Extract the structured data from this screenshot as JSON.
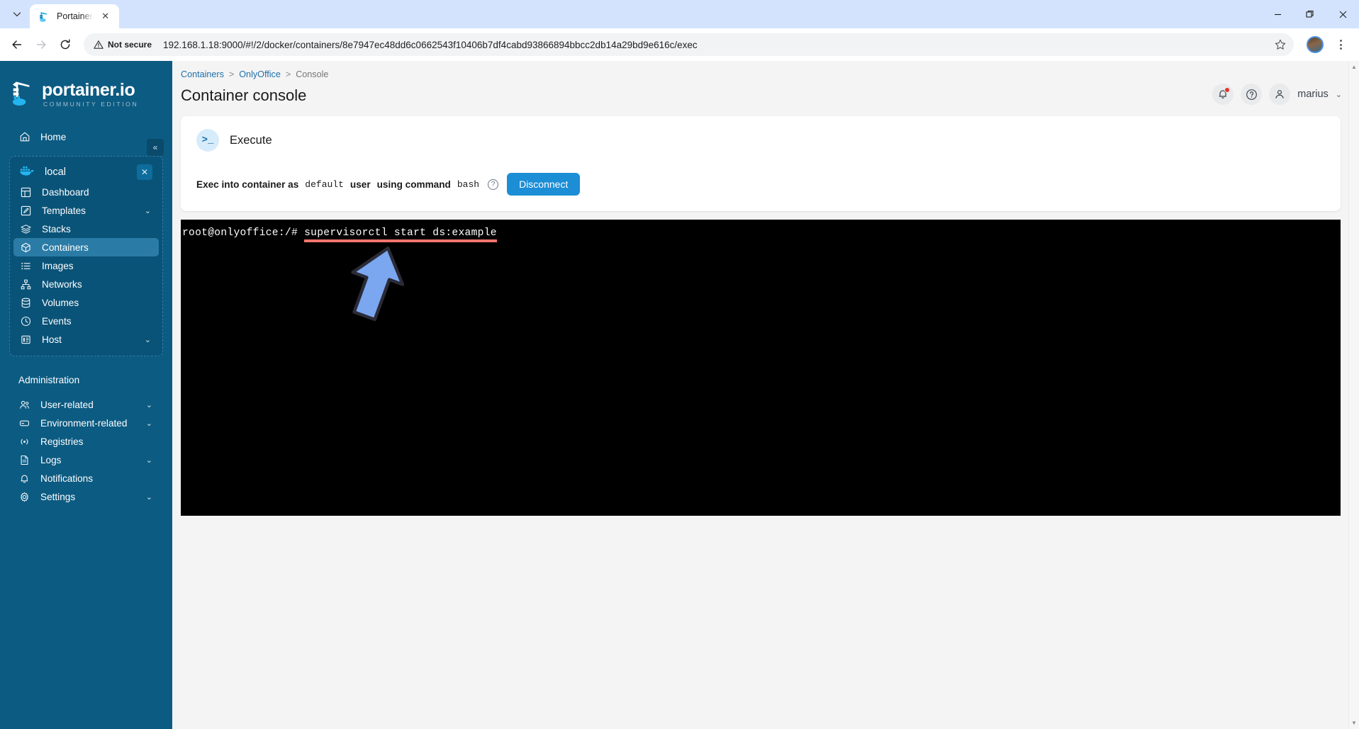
{
  "browser": {
    "tab": {
      "title": "Portainer",
      "favicon": "portainer-favicon",
      "close_label": "✕"
    },
    "tab_list_glyph": "⌄",
    "window_controls": {
      "minimize": "—",
      "maximize": "❐",
      "close": "✕"
    },
    "nav": {
      "back": "←",
      "forward": "→",
      "reload": "⟳"
    },
    "security_label": "Not secure",
    "url": "192.168.1.18:9000/#!/2/docker/containers/8e7947ec48dd6c0662543f10406b7df4cabd93866894bbcc2db14a29bd9e616c/exec",
    "star_glyph": "☆",
    "menu_label": "⋮"
  },
  "sidebar": {
    "logo_title": "portainer.io",
    "logo_subtitle": "COMMUNITY EDITION",
    "collapse_glyph": "«",
    "home": {
      "label": "Home",
      "icon": "home-icon"
    },
    "environment": {
      "name": "local",
      "icon": "docker-whale-icon",
      "close_glyph": "✕",
      "items": [
        {
          "label": "Dashboard",
          "icon": "dashboard-icon",
          "chevron": ""
        },
        {
          "label": "Templates",
          "icon": "template-edit-icon",
          "chevron": "⌄"
        },
        {
          "label": "Stacks",
          "icon": "stacks-layers-icon",
          "chevron": ""
        },
        {
          "label": "Containers",
          "icon": "container-box-icon",
          "chevron": "",
          "active": true
        },
        {
          "label": "Images",
          "icon": "images-list-icon",
          "chevron": ""
        },
        {
          "label": "Networks",
          "icon": "networks-icon",
          "chevron": ""
        },
        {
          "label": "Volumes",
          "icon": "volumes-database-icon",
          "chevron": ""
        },
        {
          "label": "Events",
          "icon": "events-clock-icon",
          "chevron": ""
        },
        {
          "label": "Host",
          "icon": "host-server-icon",
          "chevron": "⌄"
        }
      ]
    },
    "admin_section_title": "Administration",
    "admin_items": [
      {
        "label": "User-related",
        "icon": "users-icon",
        "chevron": "⌄"
      },
      {
        "label": "Environment-related",
        "icon": "environment-icon",
        "chevron": "⌄"
      },
      {
        "label": "Registries",
        "icon": "registries-broadcast-icon",
        "chevron": ""
      },
      {
        "label": "Logs",
        "icon": "logs-document-icon",
        "chevron": "⌄"
      },
      {
        "label": "Notifications",
        "icon": "bell-icon",
        "chevron": ""
      },
      {
        "label": "Settings",
        "icon": "gear-icon",
        "chevron": "⌄"
      }
    ]
  },
  "header": {
    "breadcrumb": {
      "first": "Containers",
      "second": "OnlyOffice",
      "current": "Console",
      "separator": ">"
    },
    "title": "Container console",
    "notifications_icon": "bell-icon",
    "help_icon": "help-circle-icon",
    "user_icon": "user-avatar-icon",
    "user_name": "marius",
    "user_chevron": "⌄"
  },
  "execute_card": {
    "badge_icon": "terminal-prompt-icon",
    "badge_text": ">_",
    "title": "Execute",
    "exec_prefix": "Exec into container as",
    "exec_user": "default",
    "exec_mid": "user",
    "exec_using": "using command",
    "exec_command": "bash",
    "help_glyph": "?",
    "disconnect_label": "Disconnect"
  },
  "terminal": {
    "prompt": "root@onlyoffice:/# ",
    "command": "supervisorctl start ds:example",
    "highlight_color": "#f2756e",
    "background_color": "#000000",
    "text_color": "#ffffff",
    "cursor_icon": "mouse-arrow-cursor"
  },
  "scrollbar": {
    "up_glyph": "▲",
    "down_glyph": "▼"
  },
  "colors": {
    "sidebar_bg": "#0c5b82",
    "sidebar_active": "#2a7ba5",
    "accent_blue": "#1b8ed6",
    "link_blue": "#1f70a8",
    "page_bg": "#f4f4f4"
  }
}
